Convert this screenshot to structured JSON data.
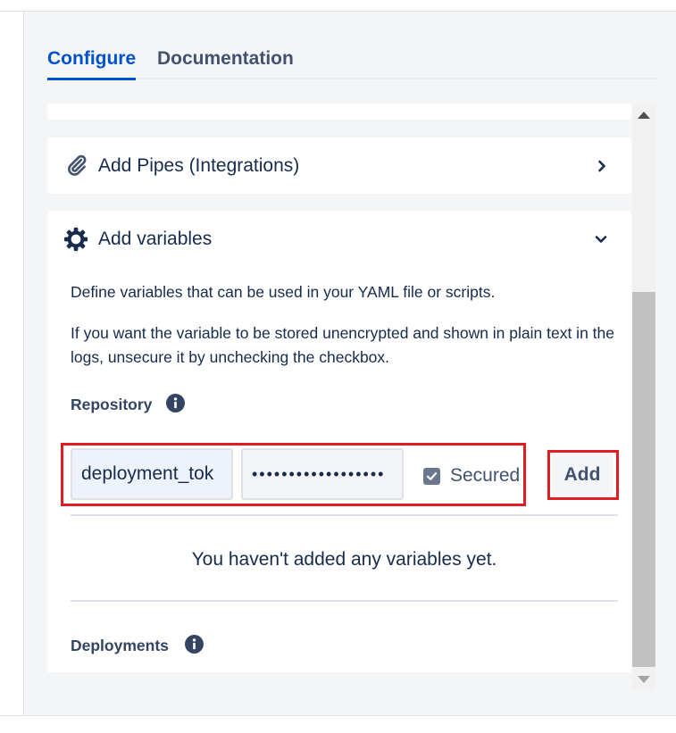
{
  "tabs": {
    "configure": "Configure",
    "documentation": "Documentation"
  },
  "pipes_section": {
    "title": "Add Pipes (Integrations)",
    "icon": "paperclip-icon",
    "chevron": "chevron-right-icon"
  },
  "variables_section": {
    "title": "Add variables",
    "icon": "gear-icon",
    "chevron": "chevron-down-icon",
    "description": "Define variables that can be used in your YAML file or scripts.",
    "secure_hint": "If you want the variable to be stored unencrypted and shown in plain text in the logs, unsecure it by unchecking the checkbox.",
    "repository_label": "Repository",
    "name_value": "deployment_tok",
    "secret_value": "••••••••••••••••••",
    "secured_label": "Secured",
    "secured_checked": true,
    "add_label": "Add",
    "empty_message": "You haven't added any variables yet.",
    "deployments_label": "Deployments"
  },
  "colors": {
    "accent": "#0052cc",
    "highlight": "#e31b23",
    "text": "#172b4d",
    "subtle_text": "#42526e"
  }
}
